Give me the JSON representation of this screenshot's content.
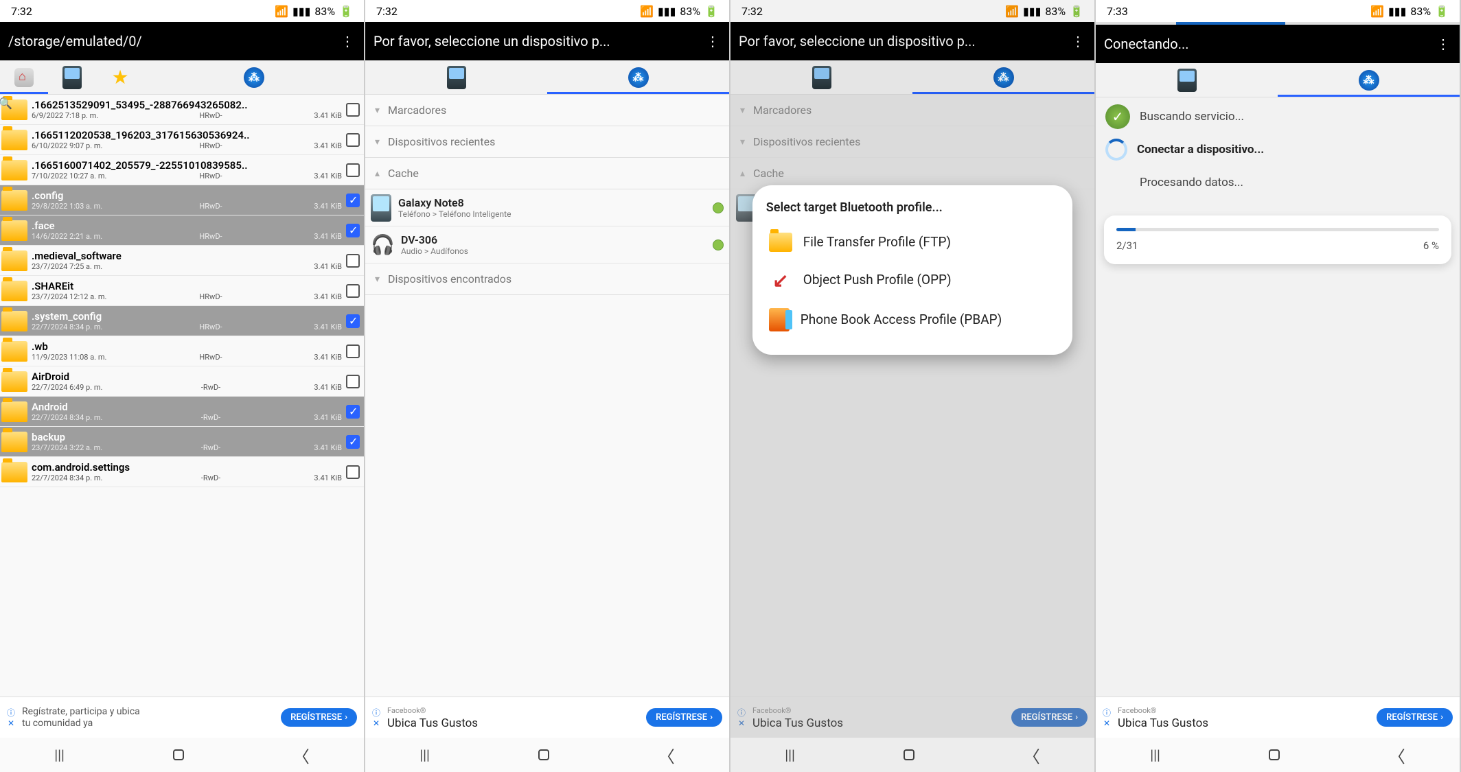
{
  "statusTime": "7:32",
  "statusTime4": "7:33",
  "battery": "83%",
  "s1": {
    "title": "/storage/emulated/0/",
    "files": [
      {
        "n": ".1662513529091_53495_-288766943265082..",
        "d": "6/9/2022 7:18 p. m.",
        "p": "HRwD-",
        "s": "3.41 KiB",
        "sel": false,
        "first": true
      },
      {
        "n": ".1665112020538_196203_317615630536924..",
        "d": "6/10/2022 9:07 p. m.",
        "p": "HRwD-",
        "s": "3.41 KiB",
        "sel": false
      },
      {
        "n": ".1665160071402_205579_-22551010839585..",
        "d": "7/10/2022 10:27 a. m.",
        "p": "HRwD-",
        "s": "3.41 KiB",
        "sel": false
      },
      {
        "n": ".config",
        "d": "29/8/2022 1:03 a. m.",
        "p": "HRwD-",
        "s": "3.41 KiB",
        "sel": true
      },
      {
        "n": ".face",
        "d": "14/6/2022 2:21 a. m.",
        "p": "HRwD-",
        "s": "3.41 KiB",
        "sel": true
      },
      {
        "n": ".medieval_software",
        "d": "23/7/2024 7:25 a. m.",
        "p": "",
        "s": "3.41 KiB",
        "sel": false
      },
      {
        "n": ".SHAREit",
        "d": "23/7/2024 12:12 a. m.",
        "p": "HRwD-",
        "s": "3.41 KiB",
        "sel": false
      },
      {
        "n": ".system_config",
        "d": "22/7/2024 8:34 p. m.",
        "p": "HRwD-",
        "s": "3.41 KiB",
        "sel": true
      },
      {
        "n": ".wb",
        "d": "11/9/2023 11:08 a. m.",
        "p": "HRwD-",
        "s": "3.41 KiB",
        "sel": false
      },
      {
        "n": "AirDroid",
        "d": "22/7/2024 6:49 p. m.",
        "p": "-RwD-",
        "s": "3.41 KiB",
        "sel": false
      },
      {
        "n": "Android",
        "d": "22/7/2024 8:34 p. m.",
        "p": "-RwD-",
        "s": "3.41 KiB",
        "sel": true
      },
      {
        "n": "backup",
        "d": "23/7/2024 3:22 a. m.",
        "p": "-RwD-",
        "s": "3.41 KiB",
        "sel": true
      },
      {
        "n": "com.android.settings",
        "d": "22/7/2024 8:34 p. m.",
        "p": "-RwD-",
        "s": "3.41 KiB",
        "sel": false
      }
    ],
    "ad": {
      "line1": "Regístrate, participa y ubica",
      "line2": "tu comunidad ya",
      "btn": "REGÍSTRESE"
    }
  },
  "s2": {
    "title": "Por favor, seleccione un dispositivo p...",
    "sections": {
      "mark": "Marcadores",
      "recent": "Dispositivos recientes",
      "cache": "Cache",
      "found": "Dispositivos encontrados"
    },
    "devs": [
      {
        "n": "Galaxy Note8",
        "sub": "Teléfono > Teléfono Inteligente",
        "icon": "phone"
      },
      {
        "n": "DV-306",
        "sub": "Audio > Audífonos",
        "icon": "head"
      }
    ],
    "ad": {
      "brand": "Facebook®",
      "line": "Ubica Tus Gustos",
      "btn": "REGÍSTRESE"
    }
  },
  "s3": {
    "title": "Por favor, seleccione un dispositivo p...",
    "dlgTitle": "Select target Bluetooth profile...",
    "items": [
      {
        "icon": "folder",
        "label": "File Transfer Profile (FTP)"
      },
      {
        "icon": "arrow",
        "label": "Object Push Profile (OPP)"
      },
      {
        "icon": "book",
        "label": "Phone Book Access Profile (PBAP)"
      }
    ]
  },
  "s4": {
    "title": "Conectando...",
    "steps": [
      {
        "icon": "done",
        "label": "Buscando servicio..."
      },
      {
        "icon": "spin",
        "label": "Conectar a dispositivo...",
        "bold": true
      },
      {
        "icon": "none",
        "label": "Procesando datos..."
      }
    ],
    "prog": {
      "count": "2/31",
      "pct": "6 %"
    }
  }
}
